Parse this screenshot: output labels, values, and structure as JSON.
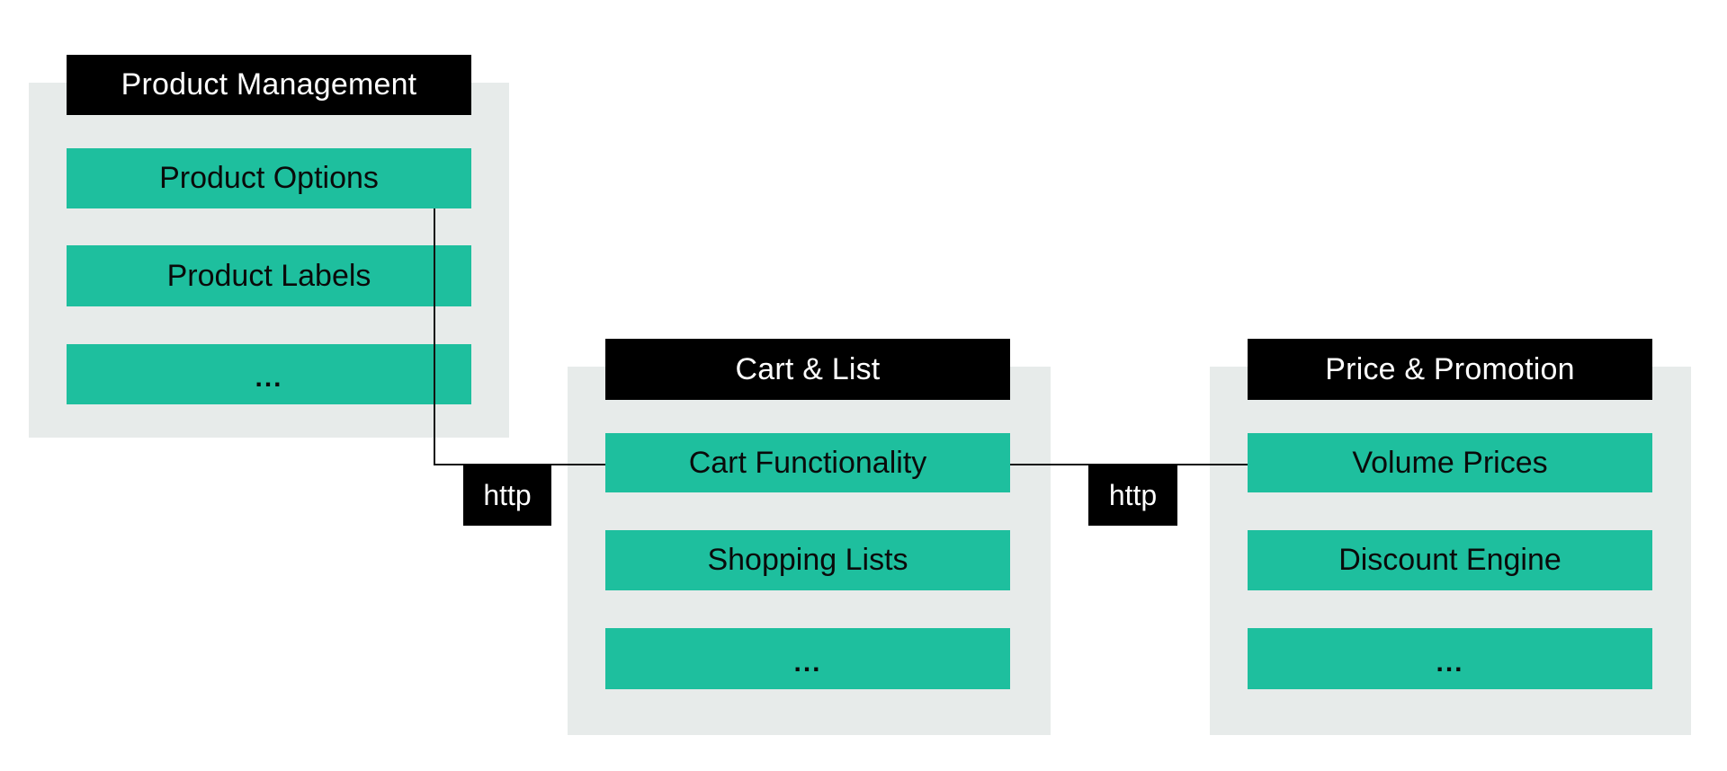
{
  "colors": {
    "background": "#ffffff",
    "panel": "#e7ebea",
    "header": "#000000",
    "item": "#1ebf9e",
    "connector": "#111111"
  },
  "groups": [
    {
      "title": "Product Management",
      "items": [
        "Product Options",
        "Product Labels",
        "..."
      ]
    },
    {
      "title": "Cart & List",
      "items": [
        "Cart Functionality",
        "Shopping Lists",
        "..."
      ]
    },
    {
      "title": "Price & Promotion",
      "items": [
        "Volume Prices",
        "Discount Engine",
        "..."
      ]
    }
  ],
  "connections": [
    {
      "from": "Product Management",
      "to": "Cart Functionality",
      "label": "http"
    },
    {
      "from": "Cart Functionality",
      "to": "Volume Prices",
      "label": "http"
    }
  ]
}
